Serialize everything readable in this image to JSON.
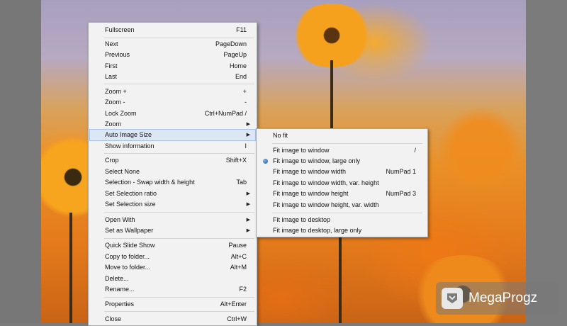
{
  "context_menu": {
    "items": [
      {
        "label": "Fullscreen",
        "key": "F11"
      },
      {
        "label": "Next",
        "key": "PageDown"
      },
      {
        "label": "Previous",
        "key": "PageUp"
      },
      {
        "label": "First",
        "key": "Home"
      },
      {
        "label": "Last",
        "key": "End"
      },
      {
        "label": "Zoom +",
        "key": "+"
      },
      {
        "label": "Zoom -",
        "key": "-"
      },
      {
        "label": "Lock Zoom",
        "key": "Ctrl+NumPad /"
      },
      {
        "label": "Zoom",
        "key": ""
      },
      {
        "label": "Auto Image Size",
        "key": ""
      },
      {
        "label": "Show information",
        "key": "I"
      },
      {
        "label": "Crop",
        "key": "Shift+X"
      },
      {
        "label": "Select None",
        "key": ""
      },
      {
        "label": "Selection - Swap width & height",
        "key": "Tab"
      },
      {
        "label": "Set Selection ratio",
        "key": ""
      },
      {
        "label": "Set Selection size",
        "key": ""
      },
      {
        "label": "Open With",
        "key": ""
      },
      {
        "label": "Set as Wallpaper",
        "key": ""
      },
      {
        "label": "Quick Slide Show",
        "key": "Pause"
      },
      {
        "label": "Copy to folder...",
        "key": "Alt+C"
      },
      {
        "label": "Move to folder...",
        "key": "Alt+M"
      },
      {
        "label": "Delete...",
        "key": ""
      },
      {
        "label": "Rename...",
        "key": "F2"
      },
      {
        "label": "Properties",
        "key": "Alt+Enter"
      },
      {
        "label": "Close",
        "key": "Ctrl+W"
      }
    ]
  },
  "auto_image_size_menu": {
    "items": [
      {
        "label": "No fit",
        "key": ""
      },
      {
        "label": "Fit image to window",
        "key": "/"
      },
      {
        "label": "Fit image to window, large only",
        "key": "",
        "selected": true
      },
      {
        "label": "Fit image to window width",
        "key": "NumPad 1"
      },
      {
        "label": "Fit image to window width, var. height",
        "key": ""
      },
      {
        "label": "Fit image to window height",
        "key": "NumPad 3"
      },
      {
        "label": "Fit image to window height, var. width",
        "key": ""
      },
      {
        "label": "Fit image to desktop",
        "key": ""
      },
      {
        "label": "Fit image to desktop, large only",
        "key": ""
      }
    ]
  },
  "watermark": {
    "text": "MegaProgz"
  },
  "colors": {
    "menu_bg": "#f2f2f2",
    "highlight": "#dce6f5",
    "radio": "#1c5aa8"
  }
}
